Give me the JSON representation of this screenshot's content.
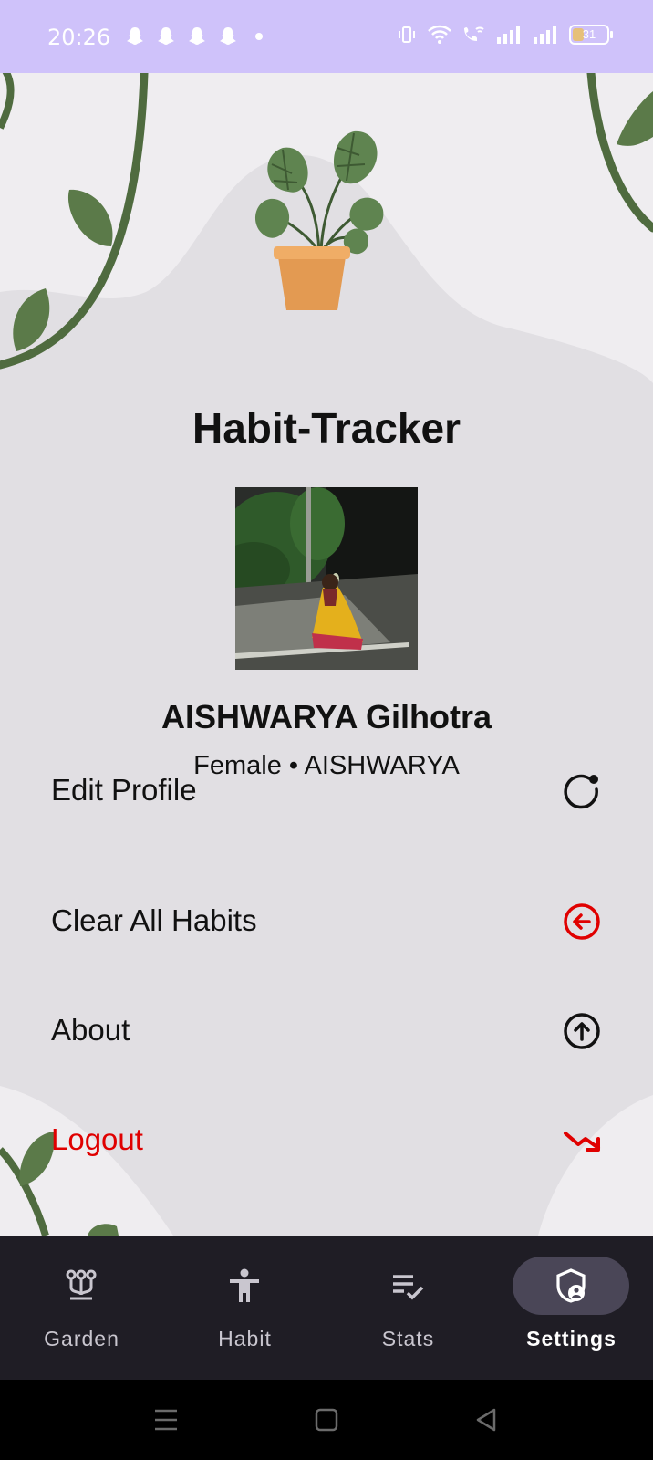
{
  "status_bar": {
    "time": "20:26",
    "battery_level": "31",
    "left_icons": [
      "snapchat-icon",
      "snapchat-icon",
      "snapchat-icon",
      "snapchat-icon",
      "dot-icon"
    ],
    "right_icons": [
      "vibrate-icon",
      "wifi-icon",
      "wifi-calling-icon",
      "signal-icon",
      "signal-icon",
      "battery-icon"
    ]
  },
  "app": {
    "title": "Habit-Tracker",
    "logo_icon": "potted-monstera-plant"
  },
  "profile": {
    "name": "AISHWARYA Gilhotra",
    "gender": "Female",
    "separator": "•",
    "username": "AISHWARYA",
    "subtitle": "Female • AISHWARYA"
  },
  "menu": {
    "items": [
      {
        "label": "Edit Profile",
        "icon": "refresh-icon",
        "color": "#111111"
      },
      {
        "label": "Clear All Habits",
        "icon": "circle-arrow-left-icon",
        "color": "#e00000"
      },
      {
        "label": "About",
        "icon": "circle-arrow-up-icon",
        "color": "#111111"
      },
      {
        "label": "Logout",
        "icon": "trending-down-icon",
        "color": "#e00000"
      }
    ]
  },
  "bottom_nav": {
    "items": [
      {
        "label": "Garden",
        "icon": "garden-icon",
        "active": false
      },
      {
        "label": "Habit",
        "icon": "person-icon",
        "active": false
      },
      {
        "label": "Stats",
        "icon": "checklist-icon",
        "active": false
      },
      {
        "label": "Settings",
        "icon": "shield-person-icon",
        "active": true
      }
    ]
  },
  "colors": {
    "status_bar": "#cfc2fa",
    "background": "#e2e0e4",
    "leaf": "#4f6b3f",
    "pot": "#e39a52",
    "danger": "#e00000",
    "nav_bg": "#1f1d25",
    "nav_active_pill": "#4a4657"
  }
}
